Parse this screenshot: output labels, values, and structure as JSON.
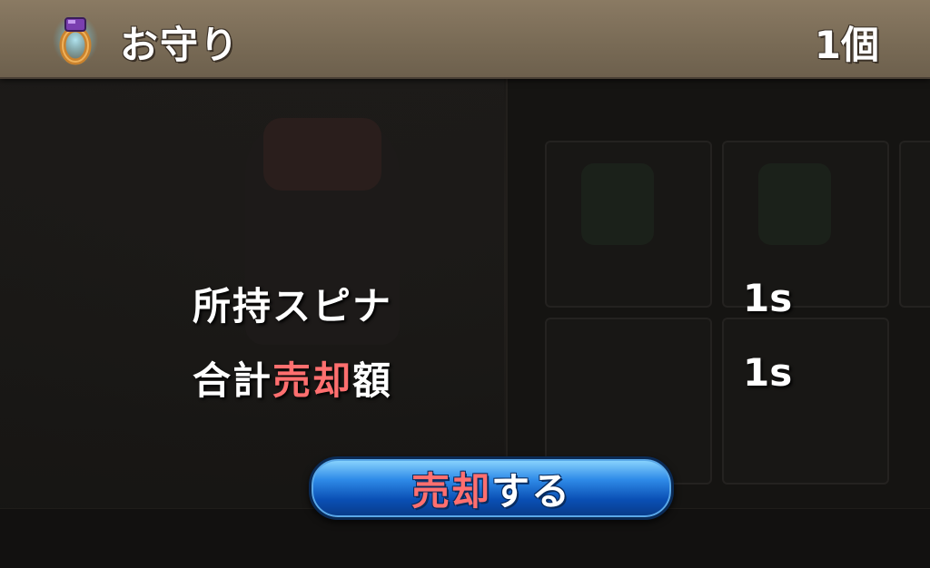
{
  "header": {
    "icon": "ring-amulet-icon",
    "title": "お守り",
    "count": "1個"
  },
  "summary": {
    "owned_label": "所持スピナ",
    "owned_value": "1s",
    "total_label_prefix": "合計",
    "total_label_highlight": "売却",
    "total_label_suffix": "額",
    "total_value": "1s"
  },
  "sell_button": {
    "highlight": "売却",
    "suffix": "する"
  },
  "colors": {
    "highlight": "#ff6f6f",
    "header": "#7c6d58",
    "button": "#2f8be8"
  }
}
